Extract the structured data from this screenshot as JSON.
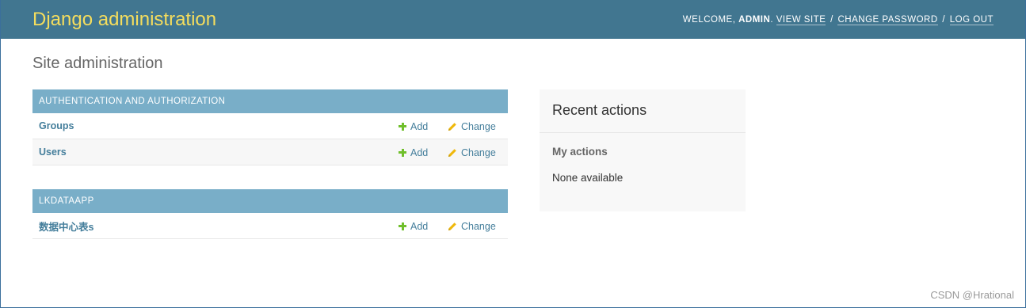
{
  "header": {
    "branding": "Django administration",
    "welcome_prefix": "WELCOME, ",
    "username": "ADMIN",
    "welcome_suffix": ".",
    "view_site": "VIEW SITE",
    "change_password": "CHANGE PASSWORD",
    "log_out": "LOG OUT",
    "separator": "/"
  },
  "page_title": "Site administration",
  "modules": [
    {
      "caption": "AUTHENTICATION AND AUTHORIZATION",
      "rows": [
        {
          "model": "Groups",
          "add": "Add",
          "change": "Change"
        },
        {
          "model": "Users",
          "add": "Add",
          "change": "Change"
        }
      ]
    },
    {
      "caption": "LKDATAAPP",
      "rows": [
        {
          "model": "数据中心表s",
          "add": "Add",
          "change": "Change"
        }
      ]
    }
  ],
  "recent_actions": {
    "title": "Recent actions",
    "subtitle": "My actions",
    "empty": "None available"
  },
  "watermark": "CSDN @Hrational",
  "colors": {
    "header_bg": "#417690",
    "branding": "#f5dd5d",
    "module_caption_bg": "#79aec8",
    "link": "#447e9b",
    "add_icon": "#70bf2b",
    "change_icon": "#efb80b"
  },
  "icons": {
    "add": "plus-icon",
    "change": "pencil-icon"
  }
}
